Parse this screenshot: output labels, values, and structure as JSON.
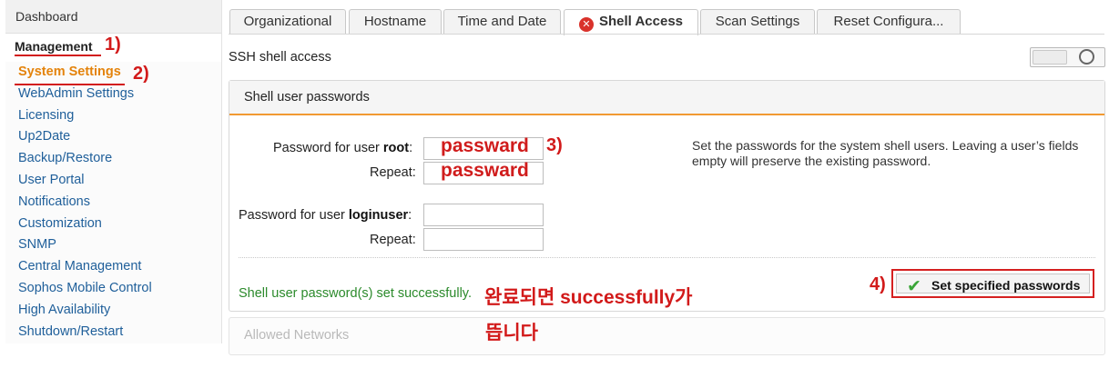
{
  "sidebar": {
    "dashboard": "Dashboard",
    "group": "Management",
    "items": [
      {
        "label": "System Settings"
      },
      {
        "label": "WebAdmin Settings"
      },
      {
        "label": "Licensing"
      },
      {
        "label": "Up2Date"
      },
      {
        "label": "Backup/Restore"
      },
      {
        "label": "User Portal"
      },
      {
        "label": "Notifications"
      },
      {
        "label": "Customization"
      },
      {
        "label": "SNMP"
      },
      {
        "label": "Central Management"
      },
      {
        "label": "Sophos Mobile Control"
      },
      {
        "label": "High Availability"
      },
      {
        "label": "Shutdown/Restart"
      }
    ]
  },
  "tabs": [
    {
      "label": "Organizational"
    },
    {
      "label": "Hostname"
    },
    {
      "label": "Time and Date"
    },
    {
      "label": "Shell Access"
    },
    {
      "label": "Scan Settings"
    },
    {
      "label": "Reset Configura..."
    }
  ],
  "ssh": {
    "label": "SSH shell access",
    "toggle_state": "off"
  },
  "panel": {
    "title": "Shell user passwords",
    "root_prefix": "Password for user ",
    "root_user": "root",
    "colon": ":",
    "repeat": "Repeat:",
    "login_prefix": "Password for user ",
    "login_user": "loginuser",
    "help": "Set the passwords for the system shell users. Leaving a user’s fields empty will preserve the existing password.",
    "success": "Shell user password(s) set successfully.",
    "button": "Set specified passwords"
  },
  "panel2": {
    "title": "Allowed Networks"
  },
  "annotations": {
    "a1": "1)",
    "a2": "2)",
    "a3": "3)",
    "a4": "4)",
    "pw1": "passward",
    "pw2": "passward",
    "note_line1": "완료되면 successfully가",
    "note_line2": "뜹니다"
  },
  "colors": {
    "accent": "#e4830b",
    "annotation": "#d21a1a",
    "success": "#2b8a2b",
    "link": "#1f5f9a"
  }
}
